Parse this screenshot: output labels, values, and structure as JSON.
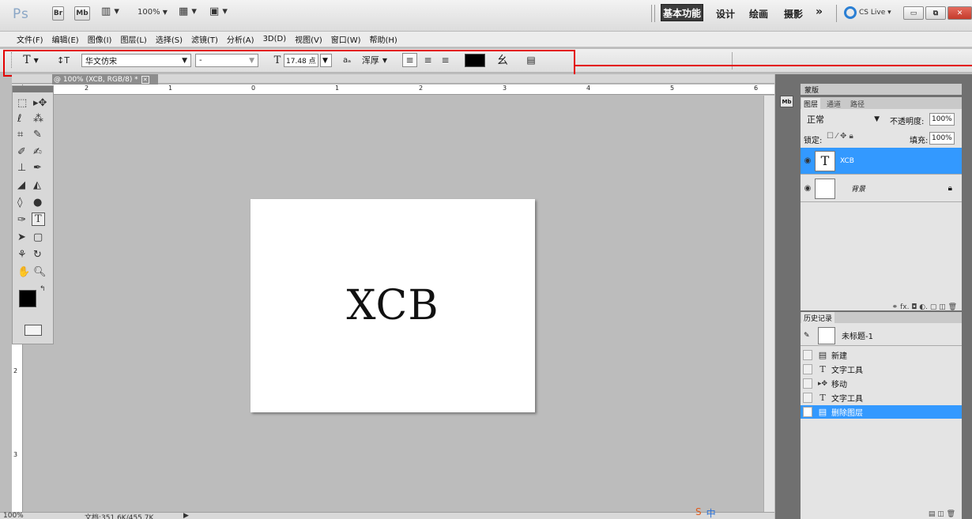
{
  "app": {
    "logo": "Ps",
    "bridge": "Br",
    "minibridge": "Mb",
    "zoom": "100%",
    "workspaces": [
      "基本功能",
      "设计",
      "绘画",
      "摄影"
    ],
    "more": "»",
    "cs_live": "CS Live ▾"
  },
  "menu": [
    "文件(F)",
    "编辑(E)",
    "图像(I)",
    "图层(L)",
    "选择(S)",
    "滤镜(T)",
    "分析(A)",
    "3D(D)",
    "视图(V)",
    "窗口(W)",
    "帮助(H)"
  ],
  "options": {
    "tool_icon": "T",
    "orient_icon": "↕T",
    "font_family": "华文仿宋",
    "font_style": "-",
    "size_icon": "T",
    "font_size": "17.48 点",
    "aa_icon": "aₐ",
    "anti_alias": "浑厚"
  },
  "document": {
    "tab_title": "@ 100% (XCB, RGB/8) *",
    "text": "XCB",
    "ruler_top": [
      "2",
      "1",
      "0",
      "1",
      "2",
      "3",
      "4",
      "5",
      "6"
    ],
    "ruler_left": [
      "2",
      "3"
    ]
  },
  "status": {
    "zoom": "100%",
    "doc_info": "文档:351.6K/455.7K"
  },
  "layers_panel": {
    "collapsed_tab": "蒙版",
    "tabs": [
      "图层",
      "通道",
      "路径"
    ],
    "blend_mode": "正常",
    "opacity_label": "不透明度:",
    "opacity": "100%",
    "lock_label": "锁定:",
    "fill_label": "填充:",
    "fill": "100%",
    "layers": [
      {
        "name": "XCB",
        "thumb": "T",
        "selected": true
      },
      {
        "name": "背景",
        "thumb": "",
        "selected": false
      }
    ],
    "footer_icons": "⚭ fx. ◘ ◐. ▢ ◫ 🗑"
  },
  "history_panel": {
    "title": "历史记录",
    "snapshot": "未标题-1",
    "items": [
      {
        "label": "新建",
        "icon": "▤"
      },
      {
        "label": "文字工具",
        "icon": "T"
      },
      {
        "label": "移动",
        "icon": "▸✥"
      },
      {
        "label": "文字工具",
        "icon": "T"
      },
      {
        "label": "删除图层",
        "icon": "▤"
      }
    ]
  },
  "colors": {
    "accent_selected": "#3399ff",
    "highlight_box": "#e30000"
  }
}
